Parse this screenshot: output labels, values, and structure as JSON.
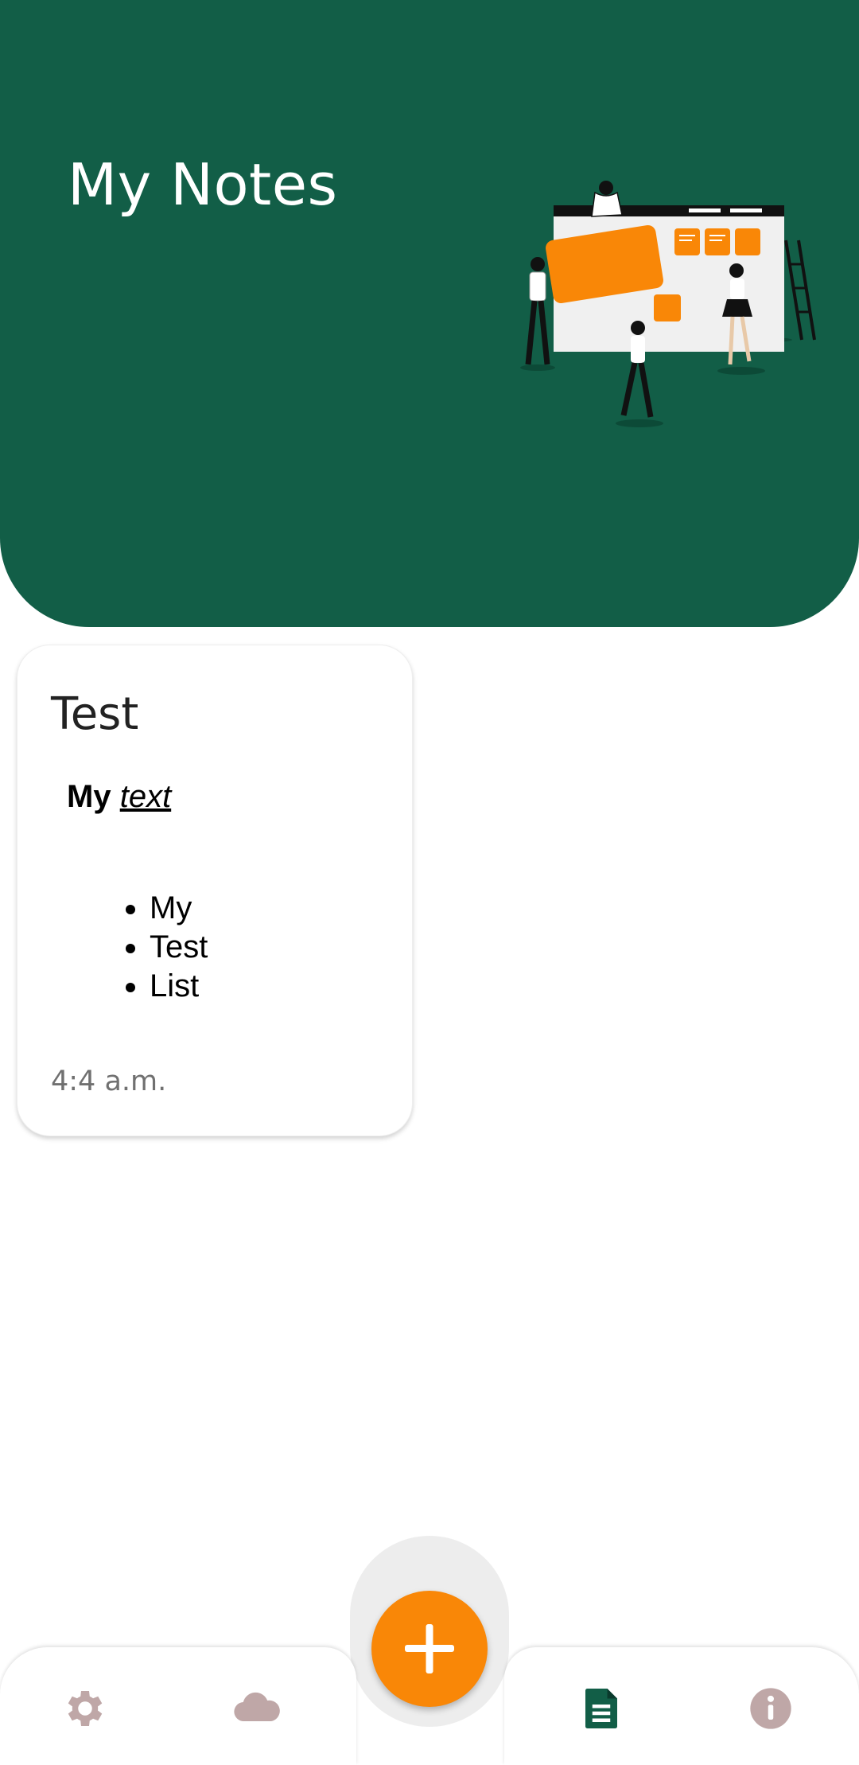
{
  "header": {
    "title": "My Notes",
    "illustration": "people-arranging-notes-board-illustration",
    "background": "#125e47",
    "accent": "#f98707"
  },
  "notes": [
    {
      "title": "Test",
      "line_bold": "My",
      "line_italic_underline": "text",
      "list": [
        "My",
        "Test",
        "List"
      ],
      "time": "4:4 a.m."
    }
  ],
  "fab": {
    "icon": "plus-icon",
    "color": "#f98707"
  },
  "bottom_nav": [
    {
      "icon": "gear-icon",
      "active": false,
      "color": "#bfa7a7"
    },
    {
      "icon": "cloud-icon",
      "active": false,
      "color": "#bfa7a7"
    },
    {
      "icon": "document-icon",
      "active": true,
      "color": "#125e47"
    },
    {
      "icon": "info-icon",
      "active": false,
      "color": "#bfa7a7"
    }
  ]
}
